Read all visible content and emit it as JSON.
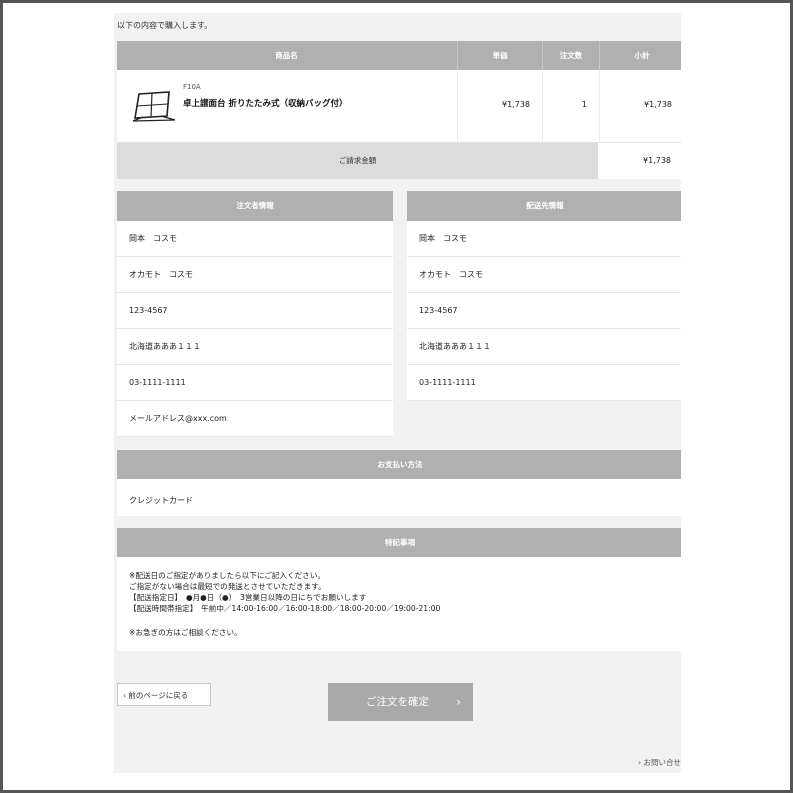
{
  "intro": "以下の内容で購入します。",
  "table": {
    "headers": {
      "name": "商品名",
      "price": "単価",
      "qty": "注文数",
      "subtotal": "小計"
    },
    "product": {
      "code": "F10A",
      "title": "卓上譜面台 折りたたみ式（収納バッグ付）",
      "price": "¥1,738",
      "qty": "1",
      "subtotal": "¥1,738"
    },
    "total_label": "ご請求金額",
    "total_value": "¥1,738"
  },
  "orderer": {
    "heading": "注文者情報",
    "name": "岡本　コスモ",
    "kana": "オカモト　コスモ",
    "postal": "123-4567",
    "address": "北海道あああ１１１",
    "phone": "03-1111-1111",
    "email": "メールアドレス@xxx.com"
  },
  "delivery": {
    "heading": "配送先情報",
    "name": "岡本　コスモ",
    "kana": "オカモト　コスモ",
    "postal": "123-4567",
    "address": "北海道あああ１１１",
    "phone": "03-1111-1111"
  },
  "payment": {
    "heading": "お支払い方法",
    "method": "クレジットカード"
  },
  "notes": {
    "heading": "特記事項",
    "lines": [
      "※配送日のご指定がありましたら以下にご記入ください。",
      "ご指定がない場合は最短での発送とさせていただきます。",
      "【配送指定日】　●月●日（●）　3営業日以降の日にちでお願いします",
      "【配送時間帯指定】　午前中／14:00-16:00／16:00-18:00／18:00-20:00／19:00-21:00",
      "",
      "※お急ぎの方はご相談ください。"
    ]
  },
  "buttons": {
    "back": "前のページに戻る",
    "confirm": "ご注文を確定",
    "contact": "お問い合せ"
  },
  "icons": {
    "back": "chevron-left-icon",
    "confirm": "chevron-right-icon",
    "contact": "chevron-right-icon"
  },
  "colors": {
    "header_gray": "#b0b0b0",
    "page_bg": "#f2f2f2",
    "button_gray": "#a9a9a9"
  }
}
